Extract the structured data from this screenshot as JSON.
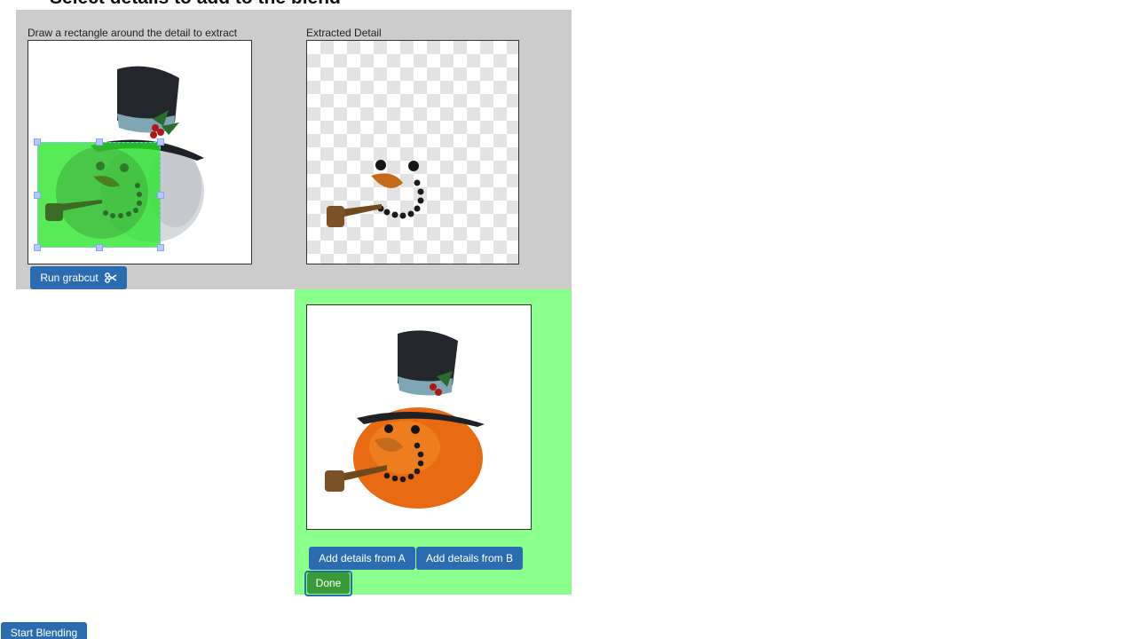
{
  "page": {
    "title": "Select details to add to the blend"
  },
  "extract_panel": {
    "left_label": "Draw a rectangle around the detail to extract",
    "right_label": "Extracted Detail",
    "run_button": "Run grabcut",
    "run_button_icon": "scissors-icon"
  },
  "blend_panel": {
    "add_a_button": "Add details from A",
    "add_b_button": "Add details from B",
    "done_button": "Done"
  },
  "footer": {
    "start_button": "Start Blending"
  },
  "colors": {
    "gray_panel": "#cccccc",
    "green_panel": "#8bff8b",
    "button_blue": "#2b6cb0",
    "button_green": "#3a9a3a",
    "selection_green": "#28e628"
  }
}
